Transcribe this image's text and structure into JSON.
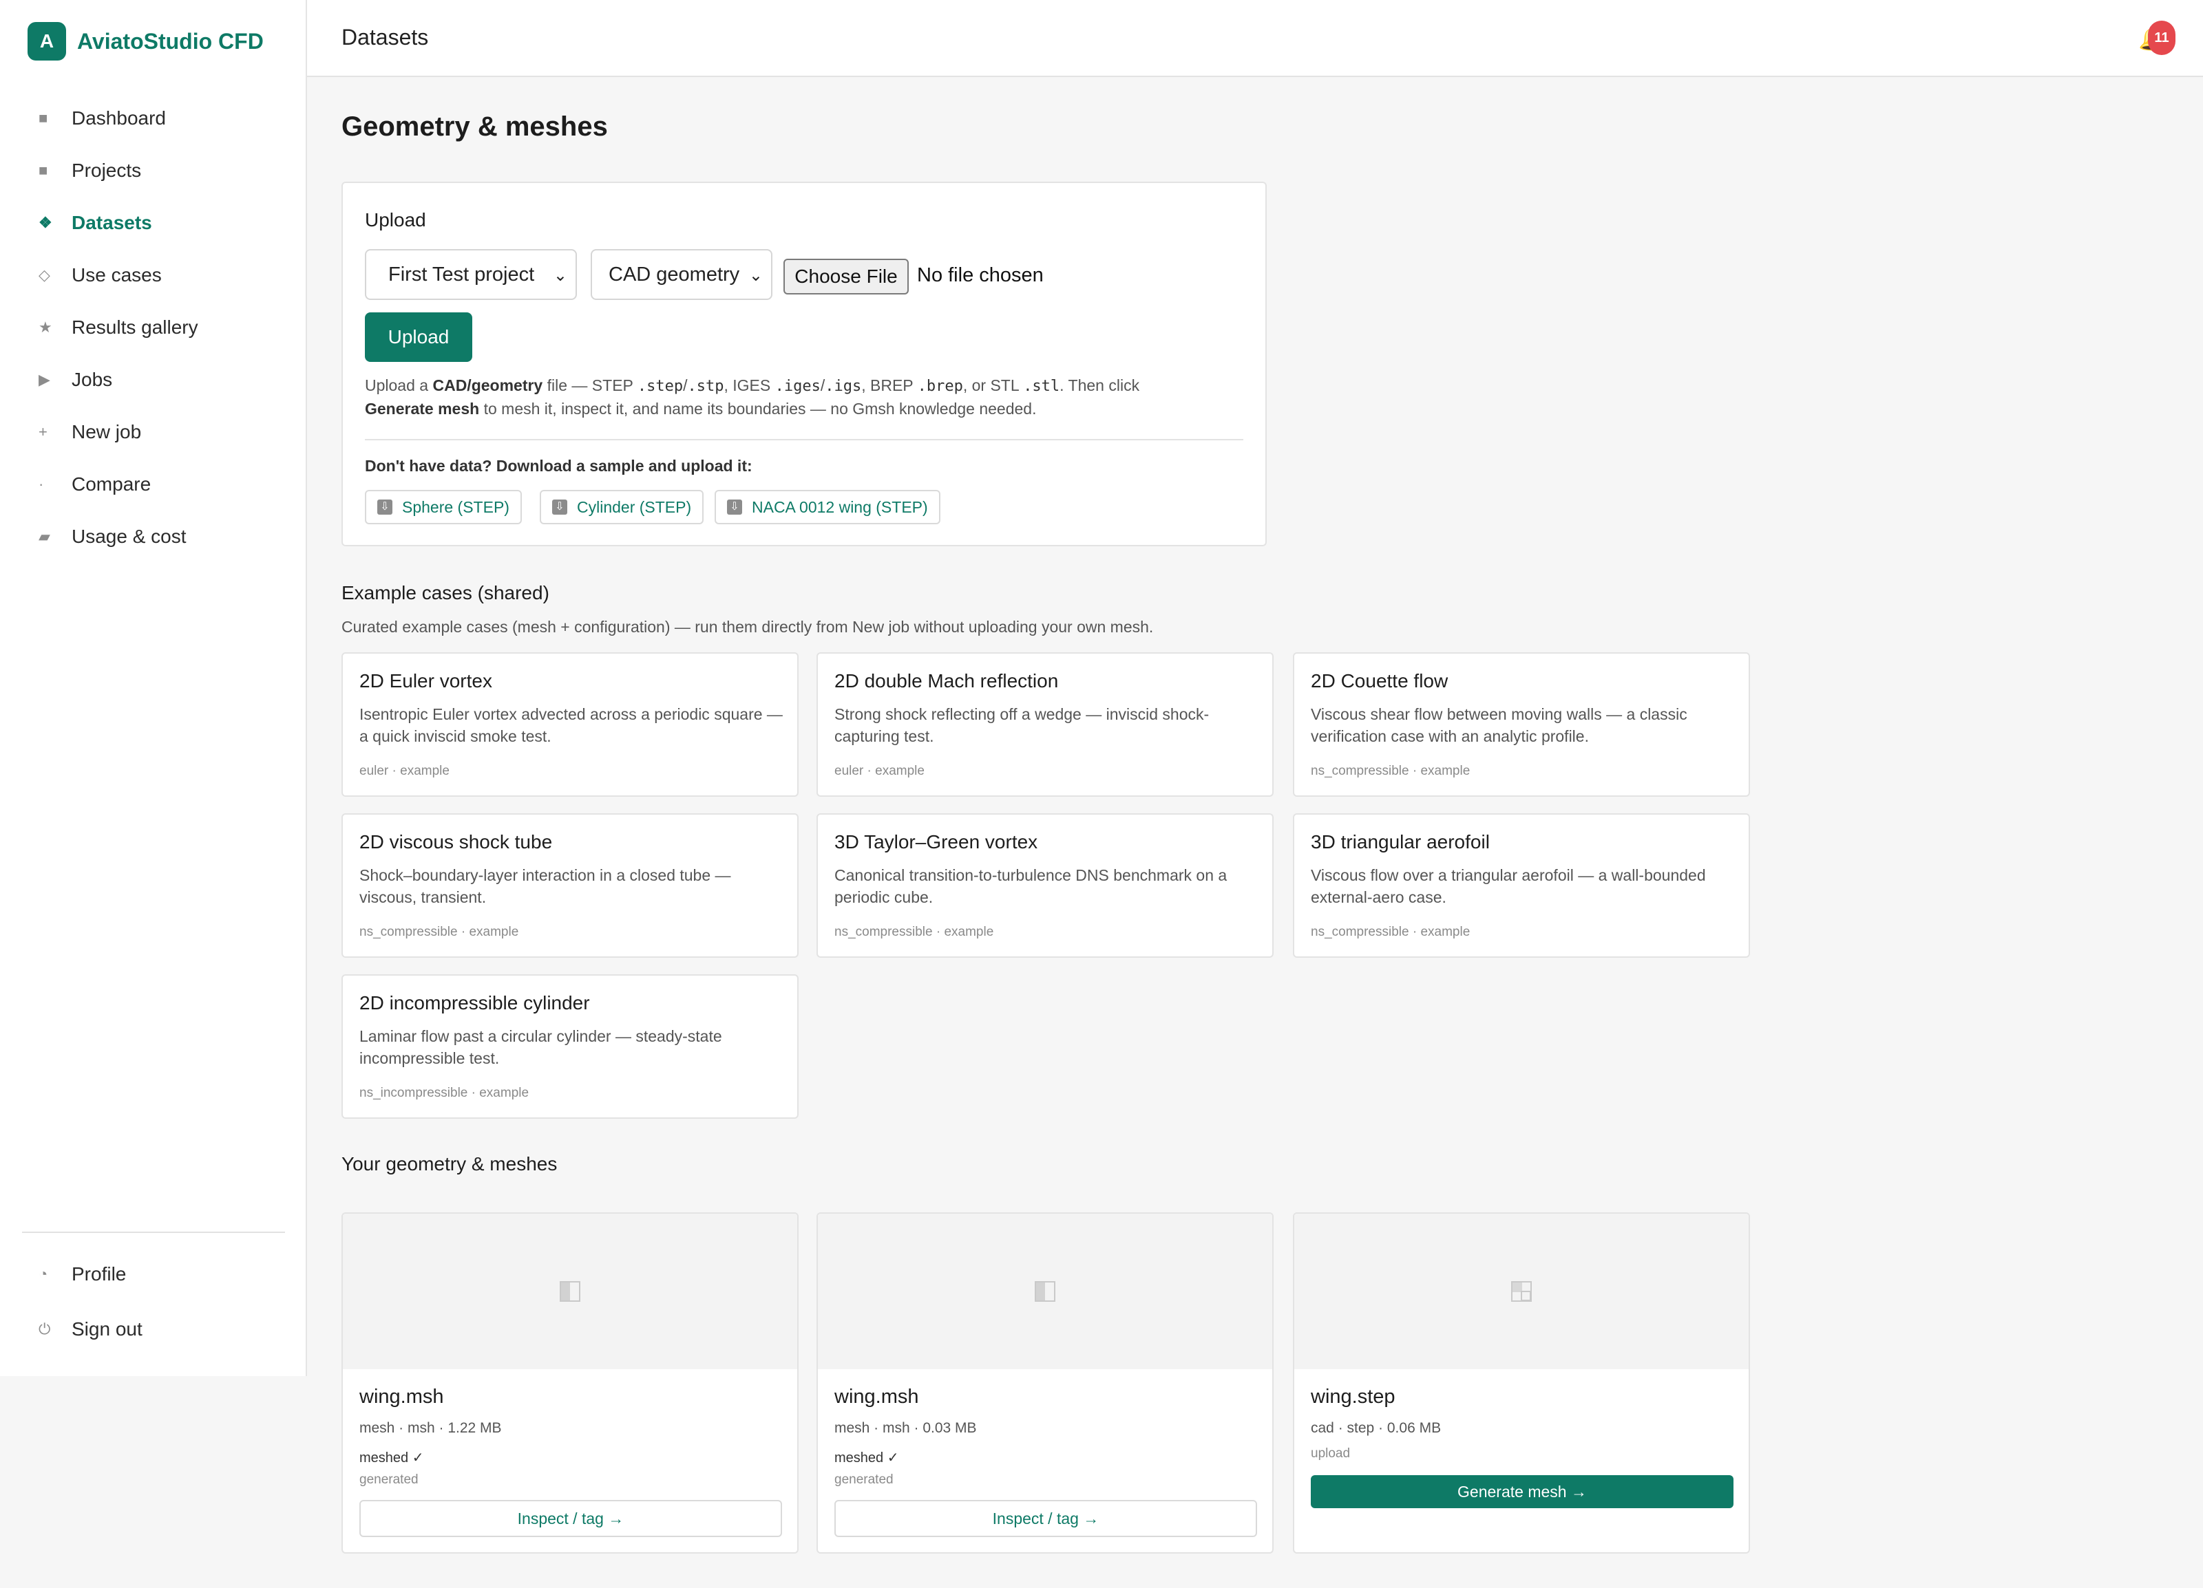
{
  "brand": {
    "logo_letter": "A",
    "name": "AviatoStudio CFD",
    "accent": "#0e7a66"
  },
  "sidebar": {
    "items": [
      {
        "label": "Dashboard",
        "icon": "square-icon",
        "glyph": "■"
      },
      {
        "label": "Projects",
        "icon": "square-icon",
        "glyph": "■"
      },
      {
        "label": "Datasets",
        "icon": "diamond-cluster-icon",
        "glyph": "❖",
        "active": true
      },
      {
        "label": "Use cases",
        "icon": "diamond-outline-icon",
        "glyph": "◇"
      },
      {
        "label": "Results gallery",
        "icon": "star-icon",
        "glyph": "★"
      },
      {
        "label": "Jobs",
        "icon": "play-icon",
        "glyph": "▶"
      },
      {
        "label": "New job",
        "icon": "plus-icon",
        "glyph": "+"
      },
      {
        "label": "Compare",
        "icon": "dot-icon",
        "glyph": "·"
      },
      {
        "label": "Usage & cost",
        "icon": "parallelogram-icon",
        "glyph": "▰"
      }
    ],
    "footer": [
      {
        "label": "Profile",
        "icon": "profile-icon",
        "glyph": "◔"
      },
      {
        "label": "Sign out",
        "icon": "power-icon",
        "glyph": "⏻"
      }
    ]
  },
  "topbar": {
    "title": "Datasets",
    "notification_count": "11",
    "bell_glyph": "🔔"
  },
  "page": {
    "title": "Geometry & meshes"
  },
  "upload": {
    "heading": "Upload",
    "project_select": "First Test project",
    "type_select": "CAD geometry",
    "choose_file_label": "Choose File",
    "file_status": "No file chosen",
    "upload_button": "Upload",
    "help": {
      "p1": "Upload a ",
      "b1": "CAD/geometry",
      "p2": " file — STEP ",
      "c1": ".step",
      "p3": "/",
      "c2": ".stp",
      "p4": ", IGES ",
      "c3": ".iges",
      "p5": "/",
      "c4": ".igs",
      "p6": ", BREP ",
      "c5": ".brep",
      "p7": ", or STL ",
      "c6": ".stl",
      "p8": ". Then click",
      "b2": "Generate mesh",
      "p9": " to mesh it, inspect it, and name its boundaries — no Gmsh knowledge needed."
    },
    "sample_title": "Don't have data? Download a sample and upload it:",
    "samples": [
      "Sphere (STEP)",
      "Cylinder (STEP)",
      "NACA 0012 wing (STEP)"
    ]
  },
  "examples": {
    "title": "Example cases (shared)",
    "subtitle": "Curated example cases (mesh + configuration) — run them directly from New job without uploading your own mesh.",
    "cards": [
      {
        "title": "2D Euler vortex",
        "desc": "Isentropic Euler vortex advected across a periodic square — a quick inviscid smoke test.",
        "meta": "euler · example"
      },
      {
        "title": "2D double Mach reflection",
        "desc": "Strong shock reflecting off a wedge — inviscid shock-capturing test.",
        "meta": "euler · example"
      },
      {
        "title": "2D Couette flow",
        "desc": "Viscous shear flow between moving walls — a classic verification case with an analytic profile.",
        "meta": "ns_compressible · example"
      },
      {
        "title": "2D viscous shock tube",
        "desc": "Shock–boundary-layer interaction in a closed tube — viscous, transient.",
        "meta": "ns_compressible · example"
      },
      {
        "title": "3D Taylor–Green vortex",
        "desc": "Canonical transition-to-turbulence DNS benchmark on a periodic cube.",
        "meta": "ns_compressible · example"
      },
      {
        "title": "3D triangular aerofoil",
        "desc": "Viscous flow over a triangular aerofoil — a wall-bounded external-aero case.",
        "meta": "ns_compressible · example"
      },
      {
        "title": "2D incompressible cylinder",
        "desc": "Laminar flow past a circular cylinder — steady-state incompressible test.",
        "meta": "ns_incompressible · example"
      }
    ]
  },
  "geometry": {
    "title": "Your geometry & meshes",
    "cards": [
      {
        "filename": "wing.msh",
        "meta": "mesh · msh · 1.22 MB",
        "status": "meshed ✓",
        "source": "generated",
        "action": "Inspect / tag →",
        "thumb_icon": "mesh-placeholder-icon"
      },
      {
        "filename": "wing.msh",
        "meta": "mesh · msh · 0.03 MB",
        "status": "meshed ✓",
        "source": "generated",
        "action": "Inspect / tag →",
        "thumb_icon": "mesh-placeholder-icon"
      },
      {
        "filename": "wing.step",
        "meta": "cad · step · 0.06 MB",
        "source": "upload",
        "action": "Generate mesh →",
        "thumb_icon": "cad-placeholder-icon"
      }
    ]
  }
}
